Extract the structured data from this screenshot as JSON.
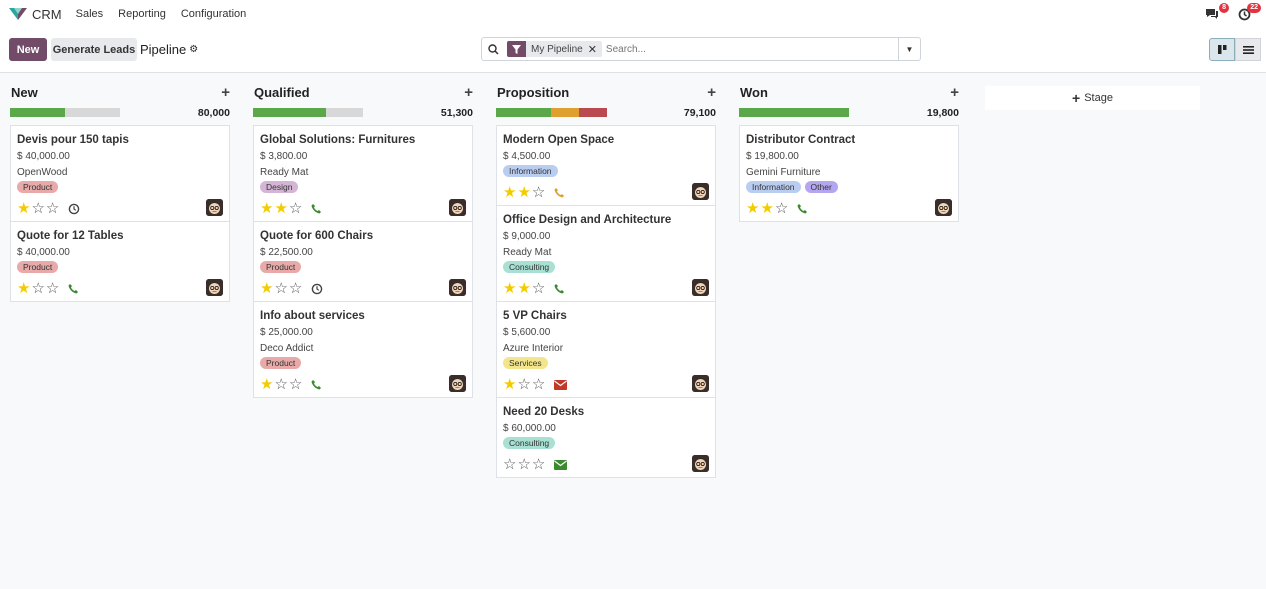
{
  "navbar": {
    "app_name": "CRM",
    "menu": [
      "Sales",
      "Reporting",
      "Configuration"
    ],
    "messages_count": "8",
    "activities_count": "22"
  },
  "control_panel": {
    "new_label": "New",
    "generate_leads_label": "Generate Leads",
    "breadcrumb": "Pipeline",
    "search_facet": "My Pipeline",
    "search_placeholder": "Search..."
  },
  "colors": {
    "brand": "#714b67",
    "green": "#5ba84b",
    "orange": "#e0a030",
    "red": "#b94a4f",
    "grey": "#d8d8d8"
  },
  "columns": [
    {
      "title": "New",
      "total": "80,000",
      "progress": [
        {
          "color": "green",
          "fraction": 0.25
        },
        {
          "color": "grey",
          "fraction": 0.25
        }
      ],
      "cards": [
        {
          "title": "Devis pour 150 tapis",
          "amount": "$ 40,000.00",
          "company": "OpenWood",
          "tags": [
            {
              "label": "Product",
              "color": "#e8a9a9"
            }
          ],
          "stars": 1,
          "activity": "clock-icon"
        },
        {
          "title": "Quote for 12 Tables",
          "amount": "$ 40,000.00",
          "company": "",
          "tags": [
            {
              "label": "Product",
              "color": "#e8a9a9"
            }
          ],
          "stars": 1,
          "activity": "phone-icon"
        }
      ]
    },
    {
      "title": "Qualified",
      "total": "51,300",
      "progress": [
        {
          "color": "green",
          "fraction": 0.33
        },
        {
          "color": "grey",
          "fraction": 0.17
        }
      ],
      "cards": [
        {
          "title": "Global Solutions: Furnitures",
          "amount": "$ 3,800.00",
          "company": "Ready Mat",
          "tags": [
            {
              "label": "Design",
              "color": "#d4b5d6"
            }
          ],
          "stars": 2,
          "activity": "phone-icon"
        },
        {
          "title": "Quote for 600 Chairs",
          "amount": "$ 22,500.00",
          "company": "",
          "tags": [
            {
              "label": "Product",
              "color": "#e8a9a9"
            }
          ],
          "stars": 1,
          "activity": "clock-icon"
        },
        {
          "title": "Info about services",
          "amount": "$ 25,000.00",
          "company": "Deco Addict",
          "tags": [
            {
              "label": "Product",
              "color": "#e8a9a9"
            }
          ],
          "stars": 1,
          "activity": "phone-icon"
        }
      ]
    },
    {
      "title": "Proposition",
      "total": "79,100",
      "progress": [
        {
          "color": "green",
          "fraction": 0.25
        },
        {
          "color": "orange",
          "fraction": 0.125
        },
        {
          "color": "red",
          "fraction": 0.125
        }
      ],
      "cards": [
        {
          "title": "Modern Open Space",
          "amount": "$ 4,500.00",
          "company": "",
          "tags": [
            {
              "label": "Information",
              "color": "#b9cdf0"
            }
          ],
          "stars": 2,
          "activity": "phone-orange-icon"
        },
        {
          "title": "Office Design and Architecture",
          "amount": "$ 9,000.00",
          "company": "Ready Mat",
          "tags": [
            {
              "label": "Consulting",
              "color": "#a8e0d3"
            }
          ],
          "stars": 2,
          "activity": "phone-icon"
        },
        {
          "title": "5 VP Chairs",
          "amount": "$ 5,600.00",
          "company": "Azure Interior",
          "tags": [
            {
              "label": "Services",
              "color": "#f3e58c"
            }
          ],
          "stars": 1,
          "activity": "email-red-icon"
        },
        {
          "title": "Need 20 Desks",
          "amount": "$ 60,000.00",
          "company": "",
          "tags": [
            {
              "label": "Consulting",
              "color": "#a8e0d3"
            }
          ],
          "stars": 0,
          "activity": "email-green-icon"
        }
      ]
    },
    {
      "title": "Won",
      "total": "19,800",
      "progress": [
        {
          "color": "green",
          "fraction": 0.5
        }
      ],
      "cards": [
        {
          "title": "Distributor Contract",
          "amount": "$ 19,800.00",
          "company": "Gemini Furniture",
          "tags": [
            {
              "label": "Information",
              "color": "#b9cdf0"
            },
            {
              "label": "Other",
              "color": "#b5a6f0"
            }
          ],
          "stars": 2,
          "activity": "phone-icon"
        }
      ]
    }
  ],
  "add_stage_label": "Stage"
}
